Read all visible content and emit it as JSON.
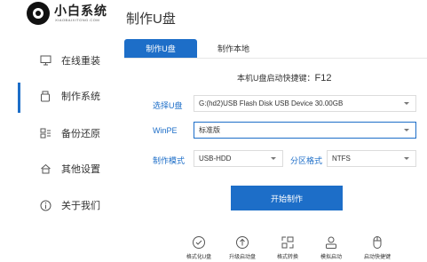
{
  "brand": {
    "name": "小白系统",
    "url": "XIAOBAIXITONG.COM"
  },
  "page_title": "制作U盘",
  "sidebar": {
    "items": [
      {
        "label": "在线重装",
        "icon": "monitor-icon",
        "active": false
      },
      {
        "label": "制作系统",
        "icon": "usb-drive-icon",
        "active": true
      },
      {
        "label": "备份还原",
        "icon": "backup-icon",
        "active": false
      },
      {
        "label": "其他设置",
        "icon": "house-icon",
        "active": false
      },
      {
        "label": "关于我们",
        "icon": "info-icon",
        "active": false
      }
    ]
  },
  "tabs": [
    {
      "label": "制作U盘",
      "active": true
    },
    {
      "label": "制作本地",
      "active": false
    }
  ],
  "hotkey": {
    "prefix": "本机U盘启动快捷键：",
    "key": "F12"
  },
  "form": {
    "usb_label": "选择U盘",
    "usb_value": "G:(hd2)USB Flash Disk USB Device 30.00GB",
    "winpe_label": "WinPE",
    "winpe_value": "标准版",
    "mode_label": "制作模式",
    "mode_value": "USB-HDD",
    "format_label": "分区格式",
    "format_value": "NTFS"
  },
  "start_button": "开始制作",
  "tools": [
    {
      "label": "格式化U盘",
      "icon": "format-check-icon"
    },
    {
      "label": "升级启动盘",
      "icon": "upgrade-arrow-icon"
    },
    {
      "label": "格式转换",
      "icon": "convert-icon"
    },
    {
      "label": "模拟启动",
      "icon": "simulate-user-icon"
    },
    {
      "label": "启动快捷键",
      "icon": "mouse-icon"
    }
  ],
  "colors": {
    "accent": "#1d6ec8",
    "text": "#333333",
    "border": "#dcdcdc"
  }
}
